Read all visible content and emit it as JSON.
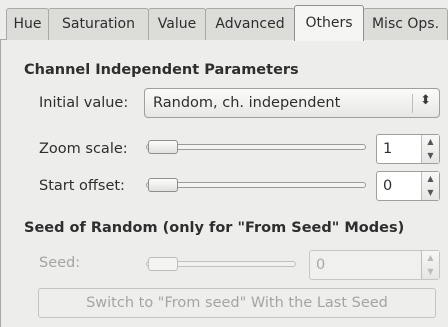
{
  "tabs": [
    {
      "label": "Hue"
    },
    {
      "label": "Saturation"
    },
    {
      "label": "Value"
    },
    {
      "label": "Advanced"
    },
    {
      "label": "Others",
      "active": true
    },
    {
      "label": "Misc Ops."
    }
  ],
  "channel_section": {
    "title": "Channel Independent Parameters",
    "initial_value_label": "Initial value:",
    "initial_value_selected": "Random, ch. independent",
    "zoom_label": "Zoom scale:",
    "zoom_value": "1",
    "offset_label": "Start offset:",
    "offset_value": "0"
  },
  "seed_section": {
    "title": "Seed of Random (only for \"From Seed\" Modes)",
    "seed_label": "Seed:",
    "seed_value": "0",
    "button_label": "Switch to \"From seed\" With the Last Seed"
  }
}
